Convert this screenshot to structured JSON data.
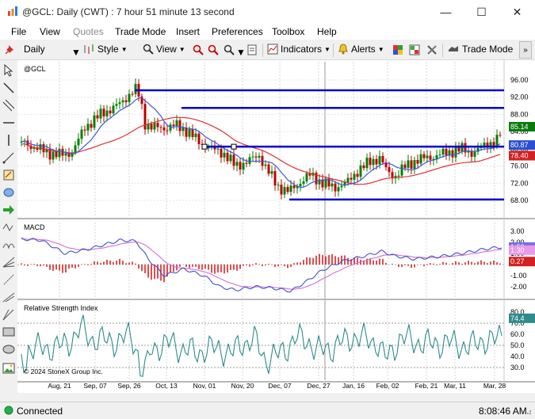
{
  "window": {
    "title": "@GCL: Daily (CWT) : 7 hour 51 minute 13 second",
    "minimize_glyph": "—",
    "maximize_glyph": "☐",
    "close_glyph": "✕"
  },
  "menu": {
    "file": "File",
    "view": "View",
    "quotes": "Quotes",
    "trade_mode": "Trade Mode",
    "insert": "Insert",
    "preferences": "Preferences",
    "toolbox": "Toolbox",
    "help": "Help"
  },
  "toolbar": {
    "interval": "Daily",
    "style": "Style",
    "view": "View",
    "indicators": "Indicators",
    "alerts": "Alerts",
    "trade_mode": "Trade Mode"
  },
  "chart": {
    "symbol_label": "@GCL",
    "macd_label": "MACD",
    "rsi_label": "Relative Strength Index",
    "copyright": "© 2024 StoneX Group Inc.",
    "price_axis": [
      "96.00",
      "92.00",
      "88.00",
      "84.00",
      "80.00",
      "76.00",
      "72.00",
      "68.00"
    ],
    "macd_axis": [
      "3.00",
      "2.00",
      "1.00",
      "-1.00",
      "-2.00"
    ],
    "rsi_axis": [
      "80.0",
      "70.0",
      "60.0",
      "50.0",
      "40.0",
      "30.0"
    ],
    "price_badges": {
      "last": "85.14",
      "ma_fast": "80.87",
      "ma_slow": "78.40"
    },
    "macd_badges": {
      "macd": "1.58",
      "signal": "1.30",
      "hist": "0.27"
    },
    "rsi_badge": "74.4",
    "x_labels": [
      "Aug, 21",
      "Sep, 07",
      "Sep, 26",
      "Oct, 13",
      "Nov, 01",
      "Nov, 20",
      "Dec, 07",
      "Dec, 27",
      "Jan, 16",
      "Feb, 02",
      "Feb, 21",
      "Mar, 11",
      "Mar, 28"
    ],
    "colors": {
      "up": "#008000",
      "down": "#c00000",
      "ma_fast": "#3a5bdc",
      "ma_slow": "#e03030",
      "support_line": "#0000cc",
      "macd_line": "#4050d0",
      "signal_line": "#d070d0",
      "hist": "#dd2222",
      "rsi_line": "#2e8b8b"
    }
  },
  "status": {
    "connection": "Connected",
    "time": "8:08:46 AM"
  }
}
